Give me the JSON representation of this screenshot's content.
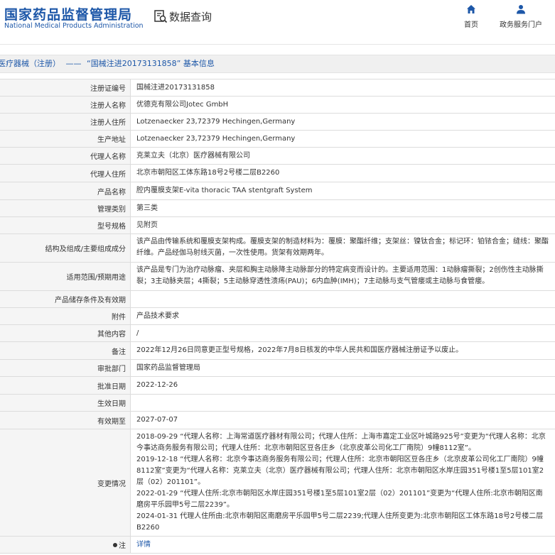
{
  "header": {
    "title": "国家药品监督管理局",
    "subtitle": "National Medical Products Administration",
    "query_label": "数据查询",
    "nav": [
      {
        "label": "首页",
        "icon": "home-icon"
      },
      {
        "label": "政务服务门户",
        "icon": "user-icon"
      }
    ]
  },
  "breadcrumb": {
    "category": "医疗器械（注册）",
    "separator": "——",
    "page": "“国械注进20173131858” 基本信息"
  },
  "fields": {
    "reg_no": {
      "label": "注册证编号",
      "value": "国械注进20173131858"
    },
    "registrant": {
      "label": "注册人名称",
      "value": "优德克有限公司Jotec GmbH"
    },
    "registrant_address": {
      "label": "注册人住所",
      "value": "Lotzenaecker 23,72379 Hechingen,Germany"
    },
    "production_address": {
      "label": "生产地址",
      "value": "Lotzenaecker 23,72379 Hechingen,Germany"
    },
    "agent": {
      "label": "代理人名称",
      "value": "克莱立夫（北京）医疗器械有限公司"
    },
    "agent_address": {
      "label": "代理人住所",
      "value": "北京市朝阳区工体东路18号2号楼二层B2260"
    },
    "product_name": {
      "label": "产品名称",
      "value": "腔内覆膜支架E-vita thoracic TAA stentgraft System"
    },
    "mgmt_class": {
      "label": "管理类别",
      "value": "第三类"
    },
    "model": {
      "label": "型号规格",
      "value": "见附页"
    },
    "structure": {
      "label": "结构及组成/主要组成成分",
      "value": "该产品由传输系统和覆膜支架构成。覆膜支架的制造材料为：覆膜：聚酯纤维；支架丝：镍钛合金；标记环：铂铱合金；缝线：聚酯纤维。产品经伽马射线灭菌，一次性使用。货架有效期两年。"
    },
    "scope": {
      "label": "适用范围/预期用途",
      "value": "该产品是专门为治疗动脉瘤、夹层和胸主动脉降主动脉部分的特定病变而设计的。主要适用范围：1动脉瘤撕裂；2创伤性主动脉撕裂；3主动脉夹层；4撕裂；5主动脉穿透性溃疡(PAU)；6内血肿(IMH)；7主动脉与支气管瘘或主动脉与食管瘘。"
    },
    "storage": {
      "label": "产品储存条件及有效期",
      "value": ""
    },
    "attachment": {
      "label": "附件",
      "value": "产品技术要求"
    },
    "other": {
      "label": "其他内容",
      "value": "/"
    },
    "remark": {
      "label": "备注",
      "value": "2022年12月26日同意更正型号规格，2022年7月8日核发的中华人民共和国医疗器械注册证予以废止。"
    },
    "approval_dept": {
      "label": "审批部门",
      "value": "国家药品监督管理局"
    },
    "approval_date": {
      "label": "批准日期",
      "value": "2022-12-26"
    },
    "effective_date": {
      "label": "生效日期",
      "value": ""
    },
    "valid_until": {
      "label": "有效期至",
      "value": "2027-07-07"
    },
    "changes": {
      "label": "变更情况",
      "items": [
        "2018-09-29 “代理人名称：上海常道医疗器材有限公司；代理人住所：上海市嘉定工业区叶城路925号”变更为“代理人名称：北京今事达商务服务有限公司；代理人住所：北京市朝阳区豆各庄乡（北京皮革公司化工厂南院）9幢8112室”。",
        "2019-12-18 “代理人名称：北京今事达商务服务有限公司；代理人住所：北京市朝阳区豆各庄乡（北京皮革公司化工厂南院）9幢8112室”变更为“代理人名称：克莱立夫（北京）医疗器械有限公司；代理人住所：北京市朝阳区水岸庄园351号楼1至5层101室2层（02）201101”。",
        "2022-01-29 “代理人住所:北京市朝阳区水岸庄园351号楼1至5层101室2层（02）201101”变更为“代理人住所:北京市朝阳区南磨房平乐园甲5号二层2239”。",
        "2024-01-31 代理人住所由:北京市朝阳区南磨房平乐园甲5号二层2239;代理人住所变更为:北京市朝阳区工体东路18号2号楼二层B2260"
      ]
    },
    "note": {
      "label": "注",
      "value": "详情",
      "icon": "bullet-icon"
    }
  }
}
